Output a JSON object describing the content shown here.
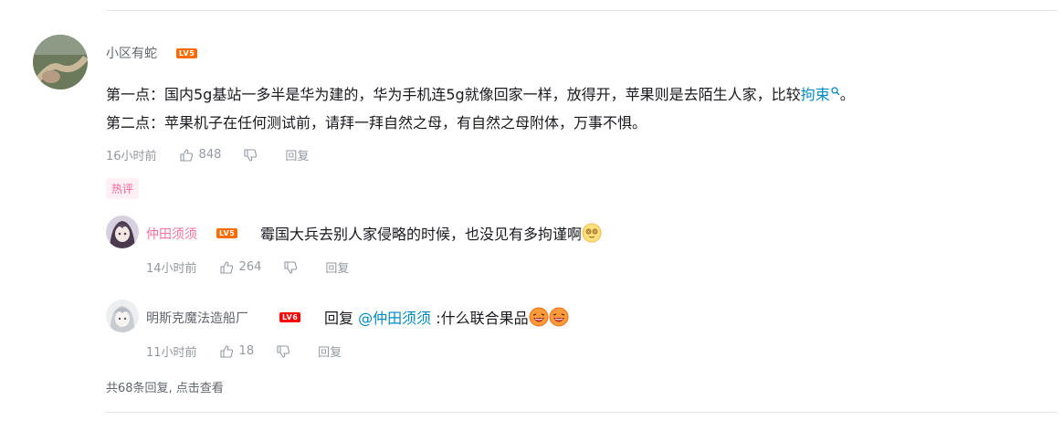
{
  "main_comment": {
    "username": "小区有蛇",
    "level": "LV5",
    "line1_prefix": "第一点：国内5g基站一多半是华为建的，华为手机连5g就像回家一样，放得开，苹果则是去陌生人家，比较",
    "line1_link": "拘束",
    "line1_suffix": "。",
    "line2": "第二点：苹果机子在任何测试前，请拜一拜自然之母，有自然之母附体，万事不惧。",
    "time": "16小时前",
    "likes": "848",
    "reply_label": "回复"
  },
  "hot_tag": "热评",
  "replies": [
    {
      "username": "仲田须须",
      "level": "LV5",
      "text": "霉国大兵去别人家侵略的时候，也没见有多拘谨啊",
      "time": "14小时前",
      "likes": "264",
      "reply_label": "回复"
    },
    {
      "username": "明斯克魔法造船厂",
      "level": "LV6",
      "prefix": "回复",
      "mention": "@仲田须须",
      "text": ":什么联合果品",
      "time": "11小时前",
      "likes": "18",
      "reply_label": "回复"
    }
  ],
  "footer": "共68条回复, 点击查看",
  "colors": {
    "link": "#008ac5",
    "meta": "#9499a0",
    "level_lv5": "#ff6c00",
    "level_lv6": "#ff0000",
    "hot_tag": "#ff6699"
  }
}
